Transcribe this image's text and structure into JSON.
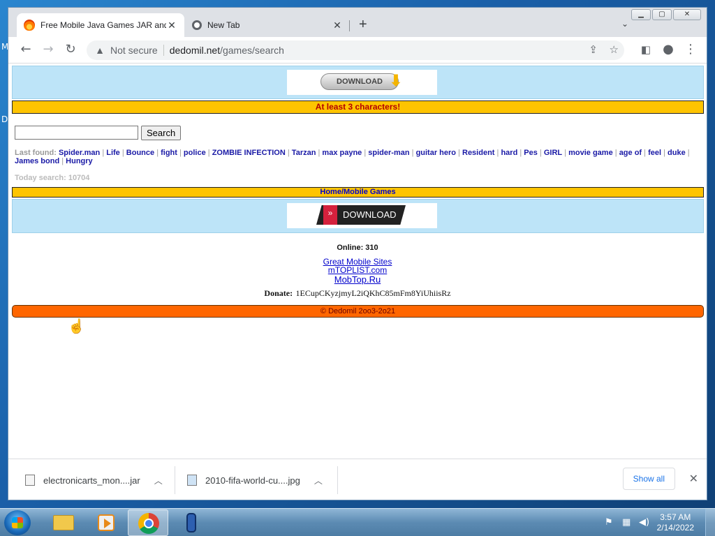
{
  "browser": {
    "tabs": [
      {
        "title": "Free Mobile Java Games JAR and",
        "active": true
      },
      {
        "title": "New Tab",
        "active": false
      }
    ],
    "new_tab_label": "+",
    "address": {
      "security_label": "Not secure",
      "host": "dedomil.net",
      "path": "/games/search"
    }
  },
  "page": {
    "banner_top": {
      "button_label": "DOWNLOAD"
    },
    "notice": "At least 3 characters!",
    "search": {
      "input_value": "",
      "button_label": "Search"
    },
    "last_found": {
      "label": "Last found:",
      "terms": [
        "Spider.man",
        "Life",
        "Bounce",
        "fight",
        "police",
        "ZOMBIE INFECTION",
        "Tarzan",
        "max payne",
        "spider-man",
        "guitar hero",
        "Resident",
        "hard",
        "Pes",
        "GIRL",
        "movie game",
        "age of",
        "feel",
        "duke",
        "James bond",
        "Hungry"
      ]
    },
    "today_search": "Today search: 10704",
    "breadcrumb": "Home/Mobile Games",
    "banner_bottom": {
      "button_label": "DOWNLOAD"
    },
    "online": "Online: 310",
    "links": [
      "Great Mobile Sites",
      "mTOPLIST.com",
      "MobTop.Ru"
    ],
    "donate_label": "Donate:",
    "donate_address": "1ECupCKyzjmyL2iQKhC85mFm8YiUhiisRz",
    "footer": "©  Dedomil 2oo3-2o21"
  },
  "downloads": {
    "items": [
      {
        "name": "electronicarts_mon....jar"
      },
      {
        "name": "2010-fifa-world-cu....jpg"
      }
    ],
    "show_all_label": "Show all"
  },
  "taskbar": {
    "time": "3:57 AM",
    "date": "2/14/2022"
  },
  "colors": {
    "notice_bar": "#fec400",
    "footer_bar": "#ff6600",
    "banner_bg": "#bde4f8",
    "link": "#1a1aa6"
  }
}
